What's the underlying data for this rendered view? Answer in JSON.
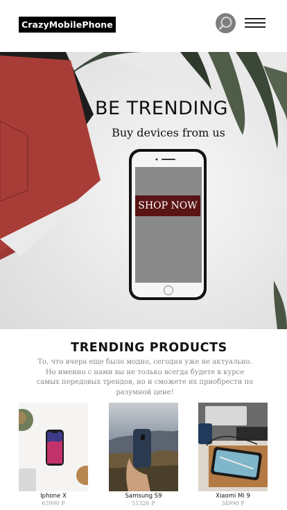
{
  "header": {
    "logo": "CrazyMobilePhone",
    "search_icon": "search-icon",
    "menu_icon": "hamburger-menu-icon"
  },
  "hero": {
    "title": "BE TRENDING",
    "subtitle": "Buy devices from us",
    "cta": "SHOP NOW",
    "colors": {
      "cta_bg": "#5a1414",
      "notebook": "#a63a35"
    }
  },
  "products": {
    "title": "TRENDING PRODUCTS",
    "description": "То, что вчера еще было модно, сегодня уже не актуально. Но именно с нами вы не только всегда будете в курсе самых передовых трендов, но и сможете их приобрести по разумной цене!",
    "items": [
      {
        "name": "Iphone X",
        "price": "63990 Р"
      },
      {
        "name": "Samsung S9",
        "price": "51326 Р"
      },
      {
        "name": "Xiaomi Mi 9",
        "price": "34990 Р"
      }
    ]
  }
}
